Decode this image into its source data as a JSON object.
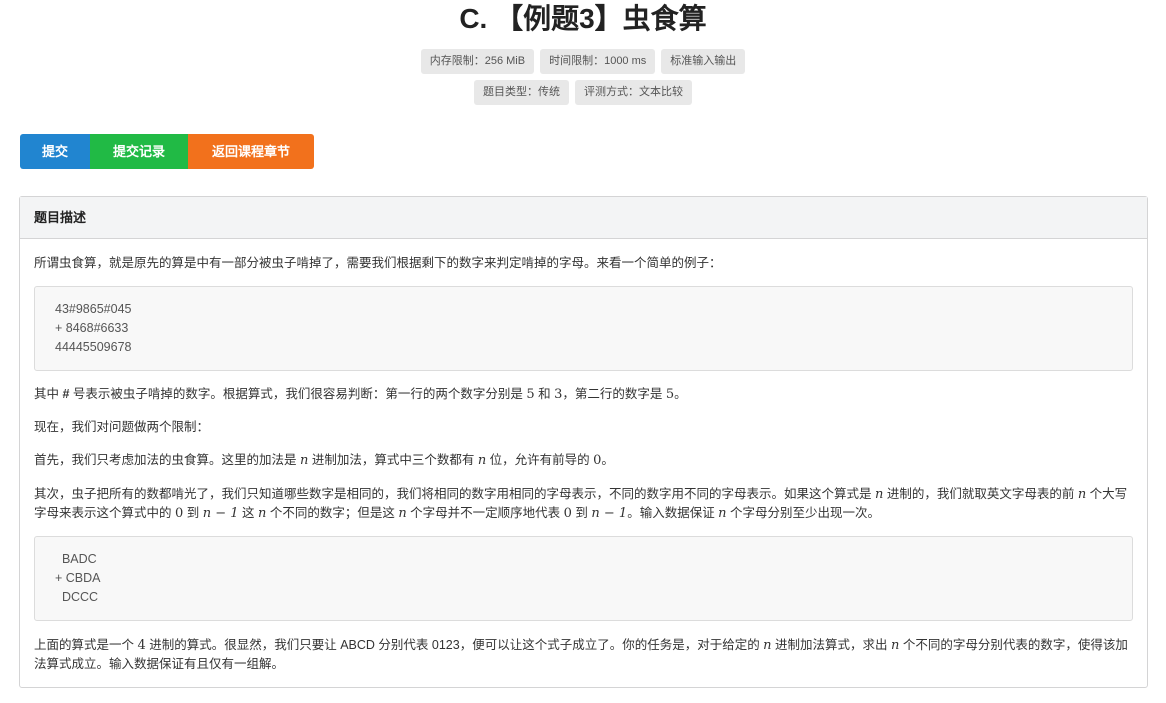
{
  "problem": {
    "title": "C. 【例题3】虫食算",
    "badges_row1": [
      "内存限制：256 MiB",
      "时间限制：1000 ms",
      "标准输入输出"
    ],
    "badges_row2": [
      "题目类型：传统",
      "评测方式：文本比较"
    ]
  },
  "actions": {
    "submit_label": "提交",
    "records_label": "提交记录",
    "back_label": "返回课程章节"
  },
  "section": {
    "header": "题目描述",
    "intro": "所谓虫食算，就是原先的算是中有一部分被虫子啃掉了，需要我们根据剩下的数字来判定啃掉的字母。来看一个简单的例子：",
    "code1": [
      "43#9865#045",
      "+ 8468#6633",
      "44445509678"
    ],
    "para_hash": {
      "a": "其中 ",
      "hash": "#",
      "b": " 号表示被虫子啃掉的数字。根据算式，我们很容易判断：第一行的两个数字分别是 ",
      "m1": "5",
      "c": " 和 ",
      "m2": "3",
      "d": "，第二行的数字是 ",
      "m3": "5",
      "e": "。"
    },
    "para_limits": "现在，我们对问题做两个限制：",
    "para_first": {
      "a": "首先，我们只考虑加法的虫食算。这里的加法是 ",
      "m1": "n",
      "b": " 进制加法，算式中三个数都有 ",
      "m2": "n",
      "c": " 位，允许有前导的 ",
      "m3": "0",
      "d": "。"
    },
    "para_second": {
      "a": "其次，虫子把所有的数都啃光了，我们只知道哪些数字是相同的，我们将相同的数字用相同的字母表示，不同的数字用不同的字母表示。如果这个算式是 ",
      "m1": "n",
      "b": " 进制的，我们就取英文字母表的前 ",
      "m2": "n",
      "c": " 个大写字母来表示这个算式中的 ",
      "m3": "0",
      "d": " 到 ",
      "m4": "n − 1",
      "e": " 这 ",
      "m5": "n",
      "f": " 个不同的数字；但是这 ",
      "m6": "n",
      "g": " 个字母并不一定顺序地代表 ",
      "m7": "0",
      "h": " 到 ",
      "m8": "n − 1",
      "i": "。输入数据保证 ",
      "m9": "n",
      "j": " 个字母分别至少出现一次。"
    },
    "code2": [
      "  BADC",
      "+ CBDA",
      "  DCCC"
    ],
    "para_last": {
      "a": "上面的算式是一个 ",
      "m1": "4",
      "b": " 进制的算式。很显然，我们只要让 ABCD 分别代表 0123，便可以让这个式子成立了。你的任务是，对于给定的 ",
      "m2": "n",
      "c": " 进制加法算式，求出 ",
      "m3": "n",
      "d": " 个不同的字母分别代表的数字，使得该加法算式成立。输入数据保证有且仅有一组解。"
    }
  }
}
